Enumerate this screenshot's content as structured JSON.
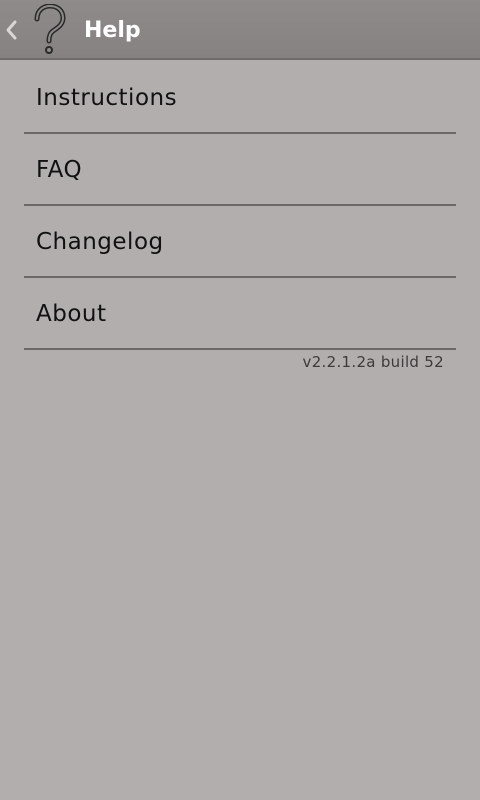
{
  "header": {
    "title": "Help",
    "back_icon": "chevron-left-icon",
    "logo_icon": "question-mark-icon"
  },
  "menu": {
    "items": [
      {
        "label": "Instructions"
      },
      {
        "label": "FAQ"
      },
      {
        "label": "Changelog"
      },
      {
        "label": "About"
      }
    ]
  },
  "footer": {
    "version": "v2.2.1.2a build 52"
  },
  "colors": {
    "background": "#b2aeae",
    "action_bar": "#8a8686",
    "divider": "#6b6868",
    "title_text": "#ffffff",
    "item_text": "#111111"
  }
}
